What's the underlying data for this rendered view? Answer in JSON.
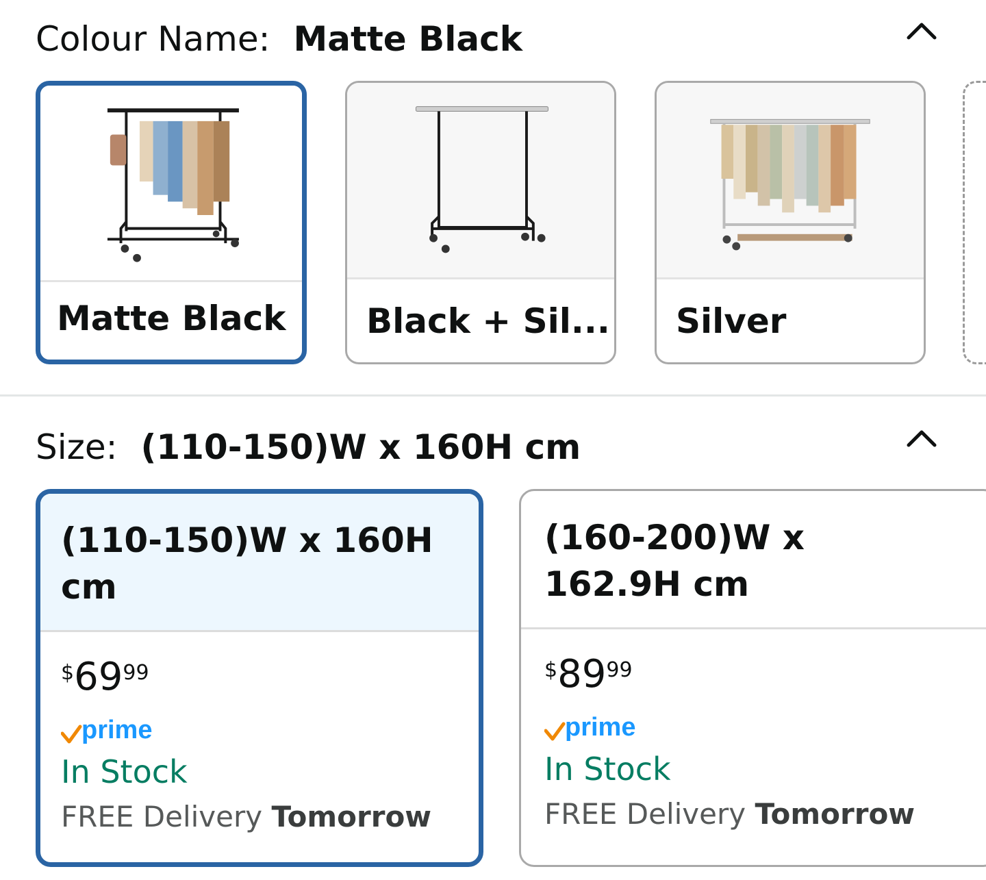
{
  "colour": {
    "label": "Colour Name:",
    "selected": "Matte Black",
    "options": [
      {
        "label": "Matte Black"
      },
      {
        "label": "Black + Sil..."
      },
      {
        "label": "Silver"
      }
    ]
  },
  "size": {
    "label": "Size:",
    "selected": "(110-150)W x 160H cm",
    "options": [
      {
        "label": "(110-150)W x 160H cm",
        "currency": "$",
        "price_whole": "69",
        "price_fraction": "99",
        "prime": "prime",
        "stock": "In Stock",
        "delivery_prefix": "FREE Delivery",
        "delivery_day": "Tomorrow"
      },
      {
        "label": "(160-200)W x 162.9H cm",
        "currency": "$",
        "price_whole": "89",
        "price_fraction": "99",
        "prime": "prime",
        "stock": "In Stock",
        "delivery_prefix": "FREE Delivery",
        "delivery_day": "Tomorrow"
      }
    ]
  },
  "colors": {
    "selected_border": "#2a64a4",
    "stock_green": "#067d62",
    "prime_blue": "#1a98ff",
    "prime_check": "#f08804"
  },
  "icons": {
    "collapse": "chevron-up-icon",
    "prime": "prime-check-icon"
  }
}
